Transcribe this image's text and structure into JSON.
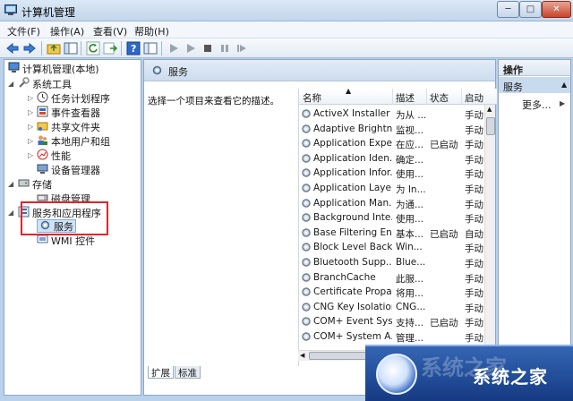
{
  "window": {
    "title": "计算机管理",
    "buttons": {
      "minimize": "─",
      "maximize": "□",
      "close": "✕"
    }
  },
  "menu": [
    "文件(F)",
    "操作(A)",
    "查看(V)",
    "帮助(H)"
  ],
  "tree": {
    "root": "计算机管理(本地)",
    "system_tools": "系统工具",
    "task_scheduler": "任务计划程序",
    "event_viewer": "事件查看器",
    "shared_folders": "共享文件夹",
    "local_users": "本地用户和组",
    "performance": "性能",
    "device_manager": "设备管理器",
    "storage": "存储",
    "disk_management": "磁盘管理",
    "services_apps": "服务和应用程序",
    "services": "服务",
    "wmi": "WMI 控件"
  },
  "center": {
    "header_title": "服务",
    "description": "选择一个项目来查看它的描述。",
    "columns": {
      "name": "名称",
      "description": "描述",
      "status": "状态",
      "startup": "启动"
    },
    "rows": [
      {
        "name": "ActiveX Installer ...",
        "desc": "为从 ...",
        "status": "",
        "startup": "手动"
      },
      {
        "name": "Adaptive Brightn...",
        "desc": "监视...",
        "status": "",
        "startup": "手动"
      },
      {
        "name": "Application Expe...",
        "desc": "在应...",
        "status": "已启动",
        "startup": "手动"
      },
      {
        "name": "Application Iden...",
        "desc": "确定...",
        "status": "",
        "startup": "手动"
      },
      {
        "name": "Application Infor...",
        "desc": "使用...",
        "status": "",
        "startup": "手动"
      },
      {
        "name": "Application Laye...",
        "desc": "为 In...",
        "status": "",
        "startup": "手动"
      },
      {
        "name": "Application Man...",
        "desc": "为通...",
        "status": "",
        "startup": "手动"
      },
      {
        "name": "Background Inte...",
        "desc": "使用...",
        "status": "",
        "startup": "手动"
      },
      {
        "name": "Base Filtering En...",
        "desc": "基本...",
        "status": "已启动",
        "startup": "自动"
      },
      {
        "name": "Block Level Back...",
        "desc": "Win...",
        "status": "",
        "startup": "手动"
      },
      {
        "name": "Bluetooth Supp...",
        "desc": "Blue...",
        "status": "",
        "startup": "手动"
      },
      {
        "name": "BranchCache",
        "desc": "此服...",
        "status": "",
        "startup": "手动"
      },
      {
        "name": "Certificate Propa...",
        "desc": "将用...",
        "status": "",
        "startup": "手动"
      },
      {
        "name": "CNG Key Isolation",
        "desc": "CNG...",
        "status": "",
        "startup": "手动"
      },
      {
        "name": "COM+ Event Sys...",
        "desc": "支持...",
        "status": "已启动",
        "startup": "手动"
      },
      {
        "name": "COM+ System A...",
        "desc": "管理...",
        "status": "",
        "startup": "手动"
      }
    ],
    "tabs": [
      "扩展",
      "标准"
    ]
  },
  "actions": {
    "header": "操作",
    "subheader": "服务",
    "more": "更多..."
  },
  "watermark": {
    "text": "系统之家"
  },
  "colors": {
    "window_bg": "#b9d1ea",
    "selection": "#cfe3f7",
    "highlight_border": "#e1252b",
    "status_running": "#1a1a1a"
  }
}
